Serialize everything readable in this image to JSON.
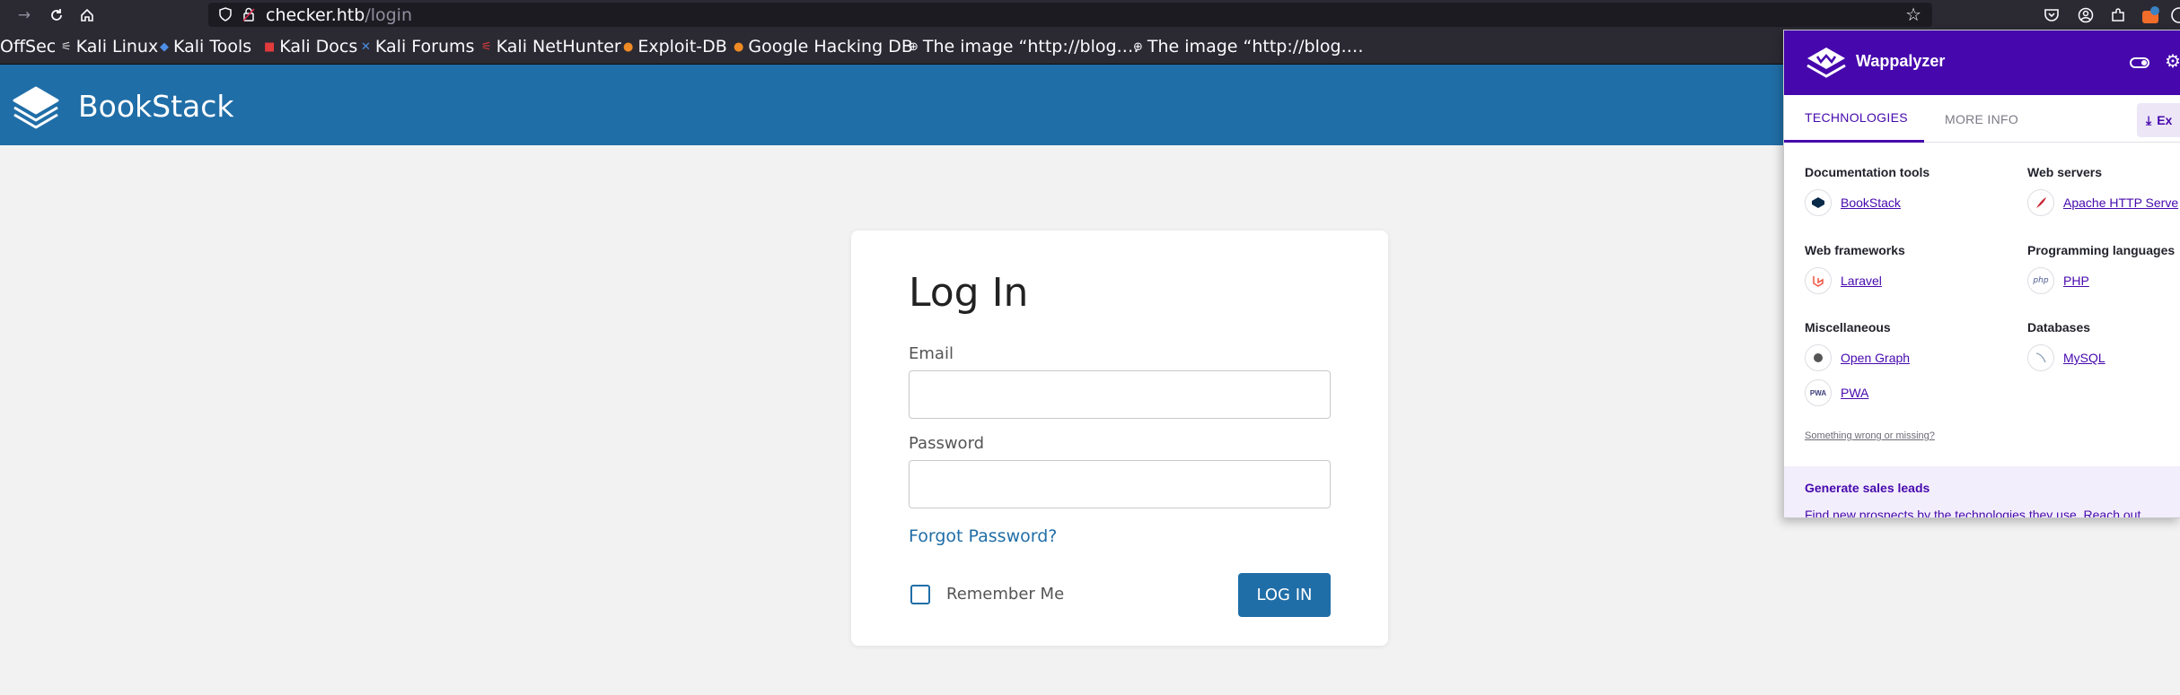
{
  "browser": {
    "url_host": "checker.htb",
    "url_path": "/login",
    "bookmarks": [
      {
        "label": "OffSec",
        "icon": ""
      },
      {
        "label": "Kali Linux",
        "icon": "kali-dragon-icon"
      },
      {
        "label": "Kali Tools",
        "icon": "kali-tools-icon"
      },
      {
        "label": "Kali Docs",
        "icon": "kali-docs-icon"
      },
      {
        "label": "Kali Forums",
        "icon": "kali-forums-icon"
      },
      {
        "label": "Kali NetHunter",
        "icon": "nethunter-icon"
      },
      {
        "label": "Exploit-DB",
        "icon": "exploit-db-icon"
      },
      {
        "label": "Google Hacking DB",
        "icon": "ghdb-icon"
      },
      {
        "label": "The image “http://blog.…",
        "icon": "globe-icon"
      },
      {
        "label": "The image “http://blog.…",
        "icon": "globe-icon"
      }
    ]
  },
  "app": {
    "name": "BookStack",
    "brand_color": "#206ea7"
  },
  "login": {
    "title": "Log In",
    "email_label": "Email",
    "email_value": "",
    "password_label": "Password",
    "password_value": "",
    "forgot_label": "Forgot Password?",
    "remember_label": "Remember Me",
    "remember_checked": false,
    "submit_label": "LOG IN"
  },
  "wappalyzer": {
    "title": "Wappalyzer",
    "accent": "#4608ad",
    "tabs": [
      "TECHNOLOGIES",
      "MORE INFO"
    ],
    "export_label": "Ex",
    "categories": [
      {
        "name": "Documentation tools",
        "techs": [
          {
            "name": "BookStack",
            "icon": "bookstack-icon"
          }
        ]
      },
      {
        "name": "Web servers",
        "techs": [
          {
            "name": "Apache HTTP Serve",
            "icon": "apache-feather-icon"
          }
        ]
      },
      {
        "name": "Web frameworks",
        "techs": [
          {
            "name": "Laravel",
            "icon": "laravel-icon"
          }
        ]
      },
      {
        "name": "Programming languages",
        "techs": [
          {
            "name": "PHP",
            "icon": "php-icon"
          }
        ]
      },
      {
        "name": "Miscellaneous",
        "techs": [
          {
            "name": "Open Graph",
            "icon": "open-graph-icon"
          },
          {
            "name": "PWA",
            "icon": "pwa-icon"
          }
        ]
      },
      {
        "name": "Databases",
        "techs": [
          {
            "name": "MySQL",
            "icon": "mysql-icon"
          }
        ]
      }
    ],
    "wrong_link": "Something wrong or missing?",
    "leads_title": "Generate sales leads",
    "leads_text": "Find new prospects by the technologies they use. Reach out"
  }
}
